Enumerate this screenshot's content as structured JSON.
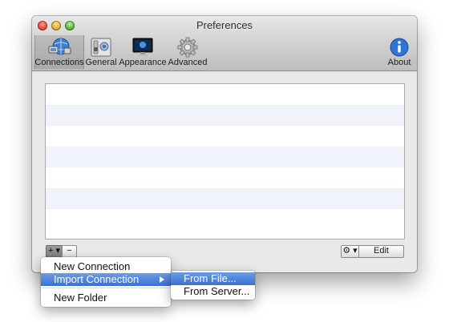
{
  "window": {
    "title": "Preferences"
  },
  "toolbar": {
    "items": [
      {
        "label": "Connections",
        "icon": "network-globe-icon",
        "selected": true
      },
      {
        "label": "General",
        "icon": "switch-panel-icon"
      },
      {
        "label": "Appearance",
        "icon": "monitor-icon"
      },
      {
        "label": "Advanced",
        "icon": "gear-icon"
      },
      {
        "label": "About",
        "icon": "info-icon"
      }
    ]
  },
  "footer": {
    "add_label": "+ ▾",
    "remove_label": "−",
    "gear_label": "⚙ ▾",
    "edit_label": "Edit"
  },
  "menu": {
    "new_connection": "New Connection",
    "import_connection": "Import Connection",
    "new_folder": "New Folder"
  },
  "submenu": {
    "from_file": "From File...",
    "from_server": "From Server..."
  },
  "colors": {
    "highlight": "#3a70d4",
    "row_alt": "#f0f4fa"
  }
}
